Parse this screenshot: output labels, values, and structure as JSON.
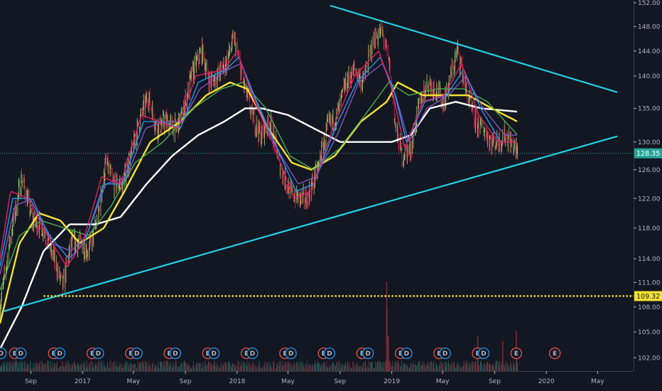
{
  "chart_data": {
    "type": "candlestick",
    "y_axis": {
      "scale": "log",
      "range": [
        100,
        152
      ],
      "ticks": [
        102,
        105,
        108,
        111,
        114,
        118,
        122,
        126,
        130,
        135,
        140,
        144,
        148,
        152
      ],
      "tick_labels": [
        "102.00",
        "105.00",
        "108.00",
        "111.00",
        "114.00",
        "118.00",
        "122.00",
        "126.00",
        "130.00",
        "135.00",
        "140.00",
        "144.00",
        "148.00",
        "152.00"
      ],
      "position": "right"
    },
    "x_axis": {
      "range": [
        "2016-06-20",
        "2020-07-25"
      ],
      "ticks": [
        {
          "date": "2016-09-01",
          "label": "Sep"
        },
        {
          "date": "2017-01-01",
          "label": "2017"
        },
        {
          "date": "2017-05-01",
          "label": "May"
        },
        {
          "date": "2017-09-01",
          "label": "Sep"
        },
        {
          "date": "2018-01-01",
          "label": "2018"
        },
        {
          "date": "2018-05-01",
          "label": "May"
        },
        {
          "date": "2018-09-01",
          "label": "Sep"
        },
        {
          "date": "2019-01-01",
          "label": "2019"
        },
        {
          "date": "2019-05-01",
          "label": "May"
        },
        {
          "date": "2019-09-01",
          "label": "Sep"
        },
        {
          "date": "2020-01-01",
          "label": "2020"
        },
        {
          "date": "2020-05-01",
          "label": "May"
        }
      ]
    },
    "price_path": [
      [
        "2016-06-20",
        108
      ],
      [
        "2016-07-15",
        117
      ],
      [
        "2016-08-10",
        125
      ],
      [
        "2016-09-05",
        119
      ],
      [
        "2016-10-01",
        118
      ],
      [
        "2016-10-25",
        114
      ],
      [
        "2016-11-15",
        110.5
      ],
      [
        "2016-12-05",
        116
      ],
      [
        "2016-12-25",
        116
      ],
      [
        "2017-01-15",
        115
      ],
      [
        "2017-02-05",
        119
      ],
      [
        "2017-02-25",
        127
      ],
      [
        "2017-03-15",
        124
      ],
      [
        "2017-04-05",
        124
      ],
      [
        "2017-04-25",
        128
      ],
      [
        "2017-05-15",
        133
      ],
      [
        "2017-06-05",
        137
      ],
      [
        "2017-06-25",
        132
      ],
      [
        "2017-07-15",
        133
      ],
      [
        "2017-08-10",
        132
      ],
      [
        "2017-08-25",
        134
      ],
      [
        "2017-09-15",
        140
      ],
      [
        "2017-10-10",
        144
      ],
      [
        "2017-10-28",
        139
      ],
      [
        "2017-11-15",
        140
      ],
      [
        "2017-12-05",
        142
      ],
      [
        "2017-12-25",
        146
      ],
      [
        "2018-01-15",
        139
      ],
      [
        "2018-02-05",
        134
      ],
      [
        "2018-02-25",
        131
      ],
      [
        "2018-03-20",
        133
      ],
      [
        "2018-04-15",
        126
      ],
      [
        "2018-05-05",
        123
      ],
      [
        "2018-05-25",
        122
      ],
      [
        "2018-06-15",
        122
      ],
      [
        "2018-07-10",
        126
      ],
      [
        "2018-08-01",
        132
      ],
      [
        "2018-08-25",
        134
      ],
      [
        "2018-09-15",
        139
      ],
      [
        "2018-10-05",
        141
      ],
      [
        "2018-10-25",
        139
      ],
      [
        "2018-11-20",
        146
      ],
      [
        "2018-12-10",
        147
      ],
      [
        "2018-12-28",
        141
      ],
      [
        "2019-01-10",
        132
      ],
      [
        "2019-01-25",
        128
      ],
      [
        "2019-02-15",
        129
      ],
      [
        "2019-03-05",
        135
      ],
      [
        "2019-03-25",
        139
      ],
      [
        "2019-04-15",
        138
      ],
      [
        "2019-05-05",
        136
      ],
      [
        "2019-05-20",
        140
      ],
      [
        "2019-06-05",
        144
      ],
      [
        "2019-06-25",
        138
      ],
      [
        "2019-07-15",
        133
      ],
      [
        "2019-08-05",
        132
      ],
      [
        "2019-08-25",
        130
      ],
      [
        "2019-09-10",
        130
      ],
      [
        "2019-09-25",
        131
      ],
      [
        "2019-10-10",
        130
      ],
      [
        "2019-10-25",
        128.35
      ]
    ],
    "moving_averages": [
      {
        "color": "#ffffff",
        "path": [
          [
            "2016-06-20",
            103
          ],
          [
            "2016-08-10",
            108
          ],
          [
            "2016-10-01",
            115
          ],
          [
            "2016-12-01",
            118.5
          ],
          [
            "2017-02-01",
            118.5
          ],
          [
            "2017-04-01",
            119.5
          ],
          [
            "2017-06-01",
            124
          ],
          [
            "2017-08-01",
            128
          ],
          [
            "2017-10-01",
            131
          ],
          [
            "2017-12-01",
            133
          ],
          [
            "2018-01-20",
            135
          ],
          [
            "2018-03-01",
            135
          ],
          [
            "2018-05-01",
            134
          ],
          [
            "2018-07-01",
            132
          ],
          [
            "2018-09-01",
            130
          ],
          [
            "2018-11-01",
            130
          ],
          [
            "2019-01-01",
            130
          ],
          [
            "2019-02-15",
            131
          ],
          [
            "2019-04-01",
            135
          ],
          [
            "2019-06-01",
            136
          ],
          [
            "2019-08-01",
            135
          ],
          [
            "2019-10-25",
            134.5
          ]
        ]
      },
      {
        "color": "#f5e133",
        "path": [
          [
            "2016-06-20",
            106
          ],
          [
            "2016-08-05",
            116
          ],
          [
            "2016-09-20",
            120
          ],
          [
            "2016-11-10",
            119
          ],
          [
            "2016-12-25",
            116
          ],
          [
            "2017-02-20",
            118
          ],
          [
            "2017-04-10",
            123
          ],
          [
            "2017-06-10",
            130
          ],
          [
            "2017-08-20",
            133
          ],
          [
            "2017-10-20",
            137
          ],
          [
            "2017-12-15",
            139
          ],
          [
            "2018-01-25",
            138
          ],
          [
            "2018-03-15",
            132
          ],
          [
            "2018-05-10",
            127
          ],
          [
            "2018-06-25",
            126
          ],
          [
            "2018-08-20",
            128
          ],
          [
            "2018-10-20",
            133
          ],
          [
            "2018-12-20",
            136
          ],
          [
            "2019-01-15",
            139
          ],
          [
            "2019-03-15",
            137
          ],
          [
            "2019-05-15",
            137
          ],
          [
            "2019-07-01",
            137
          ],
          [
            "2019-08-25",
            135
          ],
          [
            "2019-10-25",
            133
          ]
        ]
      },
      {
        "color": "#4caf50",
        "path": [
          [
            "2016-06-20",
            110
          ],
          [
            "2016-08-05",
            117
          ],
          [
            "2016-09-25",
            119
          ],
          [
            "2016-11-20",
            118
          ],
          [
            "2017-01-15",
            117
          ],
          [
            "2017-03-10",
            121
          ],
          [
            "2017-05-05",
            127
          ],
          [
            "2017-07-10",
            130
          ],
          [
            "2017-09-20",
            135
          ],
          [
            "2017-11-25",
            138
          ],
          [
            "2018-01-15",
            139
          ],
          [
            "2018-03-10",
            135
          ],
          [
            "2018-05-05",
            128
          ],
          [
            "2018-06-30",
            126
          ],
          [
            "2018-08-30",
            129
          ],
          [
            "2018-10-30",
            134
          ],
          [
            "2018-12-25",
            139
          ],
          [
            "2019-02-10",
            137
          ],
          [
            "2019-04-20",
            138
          ],
          [
            "2019-06-20",
            138
          ],
          [
            "2019-08-15",
            136
          ],
          [
            "2019-10-25",
            131
          ]
        ]
      },
      {
        "color": "#7e57c2",
        "path": [
          [
            "2016-06-20",
            112
          ],
          [
            "2016-07-25",
            121
          ],
          [
            "2016-09-05",
            122
          ],
          [
            "2016-10-20",
            116
          ],
          [
            "2016-12-05",
            115
          ],
          [
            "2017-01-10",
            117
          ],
          [
            "2017-02-25",
            124
          ],
          [
            "2017-04-15",
            125
          ],
          [
            "2017-05-30",
            132
          ],
          [
            "2017-07-10",
            133
          ],
          [
            "2017-08-25",
            133
          ],
          [
            "2017-10-05",
            138
          ],
          [
            "2017-12-10",
            141
          ],
          [
            "2018-01-10",
            142
          ],
          [
            "2018-02-15",
            136
          ],
          [
            "2018-04-05",
            129
          ],
          [
            "2018-05-25",
            124
          ],
          [
            "2018-07-05",
            125
          ],
          [
            "2018-08-25",
            131
          ],
          [
            "2018-10-15",
            139
          ],
          [
            "2018-12-10",
            142
          ],
          [
            "2019-01-10",
            137
          ],
          [
            "2019-02-10",
            130
          ],
          [
            "2019-03-25",
            135
          ],
          [
            "2019-05-15",
            137
          ],
          [
            "2019-06-25",
            140
          ],
          [
            "2019-08-05",
            135
          ],
          [
            "2019-09-25",
            131
          ],
          [
            "2019-10-25",
            131
          ]
        ]
      },
      {
        "color": "#2196f3",
        "path": [
          [
            "2016-06-20",
            113
          ],
          [
            "2016-07-20",
            122
          ],
          [
            "2016-08-30",
            122
          ],
          [
            "2016-10-15",
            117
          ],
          [
            "2016-11-30",
            114
          ],
          [
            "2017-01-05",
            116
          ],
          [
            "2017-02-20",
            124
          ],
          [
            "2017-04-05",
            124
          ],
          [
            "2017-05-25",
            133
          ],
          [
            "2017-07-05",
            133
          ],
          [
            "2017-08-20",
            132
          ],
          [
            "2017-10-01",
            139
          ],
          [
            "2017-12-05",
            141
          ],
          [
            "2018-01-05",
            143
          ],
          [
            "2018-02-10",
            137
          ],
          [
            "2018-03-30",
            130
          ],
          [
            "2018-05-20",
            123
          ],
          [
            "2018-07-01",
            124
          ],
          [
            "2018-08-20",
            132
          ],
          [
            "2018-10-10",
            139
          ],
          [
            "2018-12-05",
            143
          ],
          [
            "2019-01-05",
            138
          ],
          [
            "2019-02-05",
            130
          ],
          [
            "2019-03-20",
            136
          ],
          [
            "2019-05-10",
            137
          ],
          [
            "2019-06-20",
            141
          ],
          [
            "2019-07-30",
            135
          ],
          [
            "2019-09-15",
            130
          ],
          [
            "2019-10-25",
            130
          ]
        ]
      },
      {
        "color": "#e91e63",
        "path": [
          [
            "2016-06-20",
            114
          ],
          [
            "2016-07-15",
            123
          ],
          [
            "2016-08-25",
            122
          ],
          [
            "2016-10-10",
            117
          ],
          [
            "2016-11-25",
            113
          ],
          [
            "2017-01-01",
            116
          ],
          [
            "2017-02-15",
            125
          ],
          [
            "2017-04-01",
            124
          ],
          [
            "2017-05-20",
            134
          ],
          [
            "2017-07-01",
            133
          ],
          [
            "2017-08-15",
            132
          ],
          [
            "2017-09-25",
            140
          ],
          [
            "2017-12-01",
            141
          ],
          [
            "2018-01-01",
            144
          ],
          [
            "2018-02-05",
            137
          ],
          [
            "2018-03-25",
            130
          ],
          [
            "2018-05-15",
            122
          ],
          [
            "2018-06-25",
            123
          ],
          [
            "2018-08-15",
            132
          ],
          [
            "2018-10-05",
            140
          ],
          [
            "2018-12-01",
            144
          ],
          [
            "2019-01-01",
            138
          ],
          [
            "2019-02-01",
            129
          ],
          [
            "2019-03-15",
            136
          ],
          [
            "2019-05-05",
            137
          ],
          [
            "2019-06-15",
            142
          ],
          [
            "2019-07-25",
            134
          ],
          [
            "2019-09-10",
            130
          ],
          [
            "2019-10-25",
            130
          ]
        ]
      }
    ],
    "trendlines": [
      {
        "color": "#22d1e6",
        "from": [
          "2016-07-01",
          107.5
        ],
        "to": [
          "2020-06-15",
          130.8
        ]
      },
      {
        "color": "#22d1e6",
        "from": [
          "2018-08-10",
          151.5
        ],
        "to": [
          "2020-06-15",
          137.5
        ]
      }
    ],
    "horizontal_levels": [
      {
        "value": 128.35,
        "label": "128.35",
        "style": "dotted",
        "color": "#26a69a",
        "badge_color": "#26a69a"
      },
      {
        "value": 109.32,
        "label": "109.32",
        "style": "dotted",
        "color": "#f5e133",
        "badge_color": "#f5e133",
        "x_start": "2016-10-01"
      }
    ],
    "event_markers": [
      {
        "date": "2016-06-22",
        "kind": "dividend",
        "label": "D"
      },
      {
        "date": "2016-07-25",
        "kind": "earnings",
        "label": "E"
      },
      {
        "date": "2016-08-08",
        "kind": "dividend",
        "label": "D"
      },
      {
        "date": "2016-10-25",
        "kind": "earnings",
        "label": "E"
      },
      {
        "date": "2016-11-08",
        "kind": "dividend",
        "label": "D"
      },
      {
        "date": "2017-01-24",
        "kind": "earnings",
        "label": "E"
      },
      {
        "date": "2017-02-07",
        "kind": "dividend",
        "label": "D"
      },
      {
        "date": "2017-04-25",
        "kind": "earnings",
        "label": "E"
      },
      {
        "date": "2017-05-09",
        "kind": "dividend",
        "label": "D"
      },
      {
        "date": "2017-07-25",
        "kind": "earnings",
        "label": "E"
      },
      {
        "date": "2017-08-08",
        "kind": "dividend",
        "label": "D"
      },
      {
        "date": "2017-10-24",
        "kind": "earnings",
        "label": "E"
      },
      {
        "date": "2017-11-07",
        "kind": "dividend",
        "label": "D"
      },
      {
        "date": "2018-01-23",
        "kind": "earnings",
        "label": "E"
      },
      {
        "date": "2018-02-06",
        "kind": "dividend",
        "label": "D"
      },
      {
        "date": "2018-04-24",
        "kind": "earnings",
        "label": "E"
      },
      {
        "date": "2018-05-08",
        "kind": "dividend",
        "label": "D"
      },
      {
        "date": "2018-07-24",
        "kind": "earnings",
        "label": "E"
      },
      {
        "date": "2018-08-07",
        "kind": "dividend",
        "label": "D"
      },
      {
        "date": "2018-10-23",
        "kind": "earnings",
        "label": "E"
      },
      {
        "date": "2018-11-06",
        "kind": "dividend",
        "label": "D"
      },
      {
        "date": "2019-01-22",
        "kind": "earnings",
        "label": "E"
      },
      {
        "date": "2019-02-05",
        "kind": "dividend",
        "label": "D"
      },
      {
        "date": "2019-04-23",
        "kind": "earnings",
        "label": "E"
      },
      {
        "date": "2019-05-07",
        "kind": "dividend",
        "label": "D"
      },
      {
        "date": "2019-07-23",
        "kind": "earnings",
        "label": "E"
      },
      {
        "date": "2019-08-06",
        "kind": "dividend",
        "label": "D"
      },
      {
        "date": "2019-10-22",
        "kind": "earnings",
        "label": "E"
      },
      {
        "date": "2020-01-21",
        "kind": "earnings",
        "label": "E"
      }
    ],
    "volume": {
      "notable": [
        [
          "2018-12-20",
          0.9
        ],
        [
          "2018-12-21",
          0.65
        ],
        [
          "2018-12-24",
          0.35
        ],
        [
          "2019-10-22",
          0.4
        ],
        [
          "2019-07-23",
          0.35
        ],
        [
          "2019-09-20",
          0.3
        ]
      ]
    },
    "colors": {
      "background": "#131722",
      "up": "#26a69a",
      "down": "#ef5350",
      "ma_wick_up": "#9bd36b",
      "ma_wick_down": "#e0264f",
      "trendline": "#22d1e6",
      "axis_text": "#b2b5be"
    }
  }
}
